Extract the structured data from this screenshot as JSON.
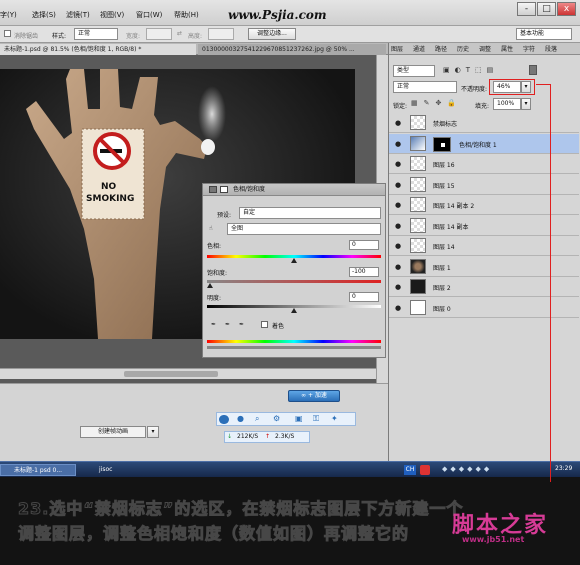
{
  "site_watermark": "www.Psjia.com",
  "menubar": {
    "items": [
      "字(Y)",
      "选择(S)",
      "滤镜(T)",
      "视图(V)",
      "窗口(W)",
      "帮助(H)"
    ],
    "workspace": "基本功能",
    "window_buttons": [
      "-",
      "□",
      "x"
    ]
  },
  "options_bar": {
    "antialias_label": "消除锯齿",
    "style_label": "样式:",
    "style_value": "正常",
    "width_label": "宽度:",
    "height_label": "高度:",
    "refine_edge_button": "调整边缘...",
    "workspace_select": "基本功能"
  },
  "doc_tabs": [
    "未标题-1.psd @ 81.5% (色相/饱和度 1, RGB/8) *",
    "01300000327541229670851237262.jpg @ 50% ..."
  ],
  "canvas": {
    "sign_text_line1": "NO",
    "sign_text_line2": "SMOKING"
  },
  "adjustments": {
    "title": "色相/饱和度",
    "preset_label": "预设:",
    "preset_value": "自定",
    "channel_value": "全图",
    "hue_label": "色相:",
    "hue_value": "0",
    "saturation_label": "饱和度:",
    "saturation_value": "-100",
    "lightness_label": "明度:",
    "lightness_value": "0",
    "colorize_label": "着色"
  },
  "timeline": {
    "create_animation_button": "创建帧动画",
    "speed_up": "212K/S",
    "speed_down": "2.3K/S",
    "net_label": "∞ + 加速"
  },
  "layers_panel": {
    "tabs": [
      "图层",
      "通道",
      "路径",
      "历史",
      "调整",
      "属性",
      "字符",
      "段落"
    ],
    "kind_filter": "类型",
    "blend_mode": "正常",
    "opacity_label": "不透明度:",
    "opacity_value": "46%",
    "lock_label": "锁定:",
    "fill_label": "填充:",
    "fill_value": "100%",
    "layers": [
      {
        "name": "禁烟标志",
        "type": "transparent",
        "selected": false
      },
      {
        "name": "色相/饱和度 1",
        "type": "adjustment",
        "selected": true
      },
      {
        "name": "图层 16",
        "type": "transparent",
        "selected": false
      },
      {
        "name": "图层 15",
        "type": "transparent",
        "selected": false
      },
      {
        "name": "图层 14 副本 2",
        "type": "transparent",
        "selected": false
      },
      {
        "name": "图层 14 副本",
        "type": "transparent",
        "selected": false
      },
      {
        "name": "图层 14",
        "type": "transparent",
        "selected": false
      },
      {
        "name": "图层 1",
        "type": "hand",
        "selected": false
      },
      {
        "name": "图层 2",
        "type": "dark",
        "selected": false
      },
      {
        "name": "图层 0",
        "type": "white",
        "selected": false
      }
    ]
  },
  "taskbar": {
    "items": [
      "未标题-1 psd 0...",
      "jisoc"
    ],
    "clock": "23:29",
    "tray_label": "CH"
  },
  "caption": {
    "line1": "23.选中“禁烟标志”的选区，在禁烟标志图层下方新建一个",
    "line2": "调整图层，调整色相饱和度（数值如图）再调整它的"
  },
  "watermark_logo": {
    "title": "脚本之家",
    "url": "www.jb51.net"
  },
  "colors": {
    "selected_layer": "#aec6ec",
    "highlight": "#e02020",
    "logo_pink": "#d63b96"
  }
}
